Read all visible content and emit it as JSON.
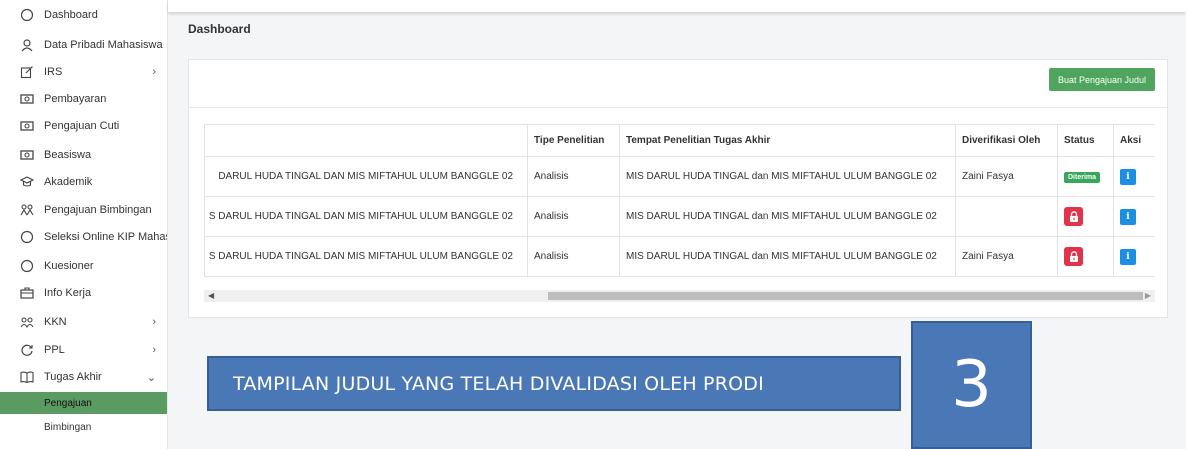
{
  "sidebar": {
    "items": [
      {
        "label": "Dashboard",
        "icon": "dashboard-icon"
      },
      {
        "label": "Data Pribadi Mahasiswa",
        "icon": "user-icon"
      },
      {
        "label": "IRS",
        "icon": "edit-icon",
        "chevron": "›"
      },
      {
        "label": "Pembayaran",
        "icon": "money-icon"
      },
      {
        "label": "Pengajuan Cuti",
        "icon": "money-icon"
      },
      {
        "label": "Beasiswa",
        "icon": "money-icon"
      },
      {
        "label": "Akademik",
        "icon": "graduation-icon"
      },
      {
        "label": "Pengajuan Bimbingan",
        "icon": "people-icon"
      },
      {
        "label": "Seleksi Online KIP Mahasiswa",
        "icon": "circle-icon"
      },
      {
        "label": "Kuesioner",
        "icon": "circle-icon"
      },
      {
        "label": "Info Kerja",
        "icon": "briefcase-icon"
      },
      {
        "label": "KKN",
        "icon": "users-icon",
        "chevron": "›"
      },
      {
        "label": "PPL",
        "icon": "refresh-icon",
        "chevron": "›"
      },
      {
        "label": "Tugas Akhir",
        "icon": "book-icon",
        "chevron": "⌄"
      }
    ],
    "sub_items": [
      {
        "label": "Pengajuan",
        "active": true
      },
      {
        "label": "Bimbingan",
        "active": false
      }
    ]
  },
  "page": {
    "title": "Dashboard"
  },
  "card": {
    "add_button": "Buat Pengajuan Judul"
  },
  "table": {
    "headers": [
      "",
      "Tipe Penelitian",
      "Tempat Penelitian Tugas Akhir",
      "Diverifikasi Oleh",
      "Status",
      "Aksi"
    ],
    "rows": [
      {
        "judul": "DARUL HUDA TINGAL DAN MIS MIFTAHUL ULUM BANGGLE 02",
        "tipe": "Analisis",
        "tempat": "MIS DARUL HUDA TINGAL dan MIS MIFTAHUL ULUM BANGGLE 02",
        "verifikasi": "Zaini Fasya",
        "status": "Diterima"
      },
      {
        "judul": "S DARUL HUDA TINGAL DAN MIS MIFTAHUL ULUM BANGGLE 02",
        "tipe": "Analisis",
        "tempat": "MIS DARUL HUDA TINGAL dan MIS MIFTAHUL ULUM BANGGLE 02",
        "verifikasi": "",
        "status": "locked"
      },
      {
        "judul": "S DARUL HUDA TINGAL DAN MIS MIFTAHUL ULUM BANGGLE 02",
        "tipe": "Analisis",
        "tempat": "MIS DARUL HUDA TINGAL dan MIS MIFTAHUL ULUM BANGGLE 02",
        "verifikasi": "Zaini Fasya",
        "status": "locked"
      }
    ]
  },
  "annotation": {
    "caption": "TAMPILAN JUDUL YANG TELAH DIVALIDASI OLEH PRODI",
    "number": "3"
  },
  "colors": {
    "active_green": "#5a9b62",
    "button_green": "#4fa55e",
    "lock_red": "#e0344b",
    "info_blue": "#1d8fe0",
    "callout_blue": "#4a77b6"
  }
}
